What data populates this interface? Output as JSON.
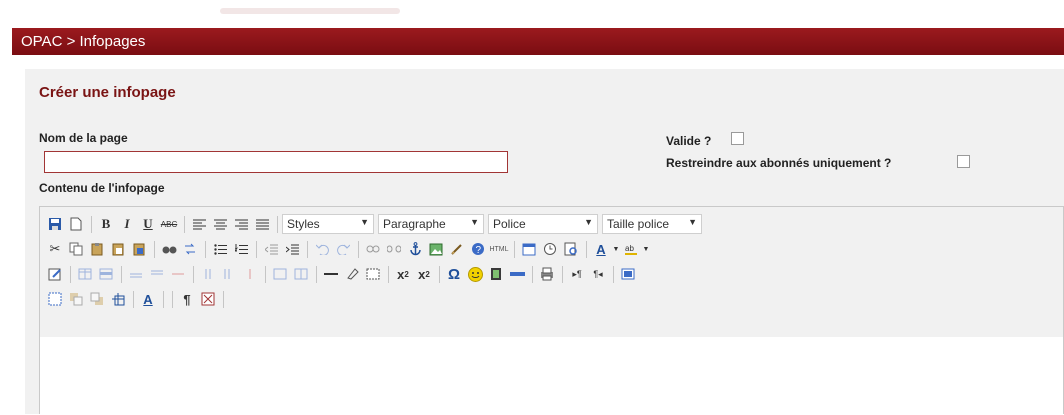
{
  "breadcrumb": "OPAC > Infopages",
  "panel": {
    "heading": "Créer une infopage",
    "name_label": "Nom de la page",
    "name_value": "",
    "valid_label": "Valide ?",
    "restrict_label": "Restreindre aux abonnés uniquement ?",
    "content_label": "Contenu de l'infopage"
  },
  "editor": {
    "styles_label": "Styles",
    "paragraph_label": "Paragraphe",
    "font_label": "Police",
    "size_label": "Taille police",
    "html_label": "HTML",
    "text_color_label": "A",
    "abc_label": "ABC"
  },
  "colors": {
    "accent": "#8b1116",
    "panel": "#f1f1f1"
  }
}
